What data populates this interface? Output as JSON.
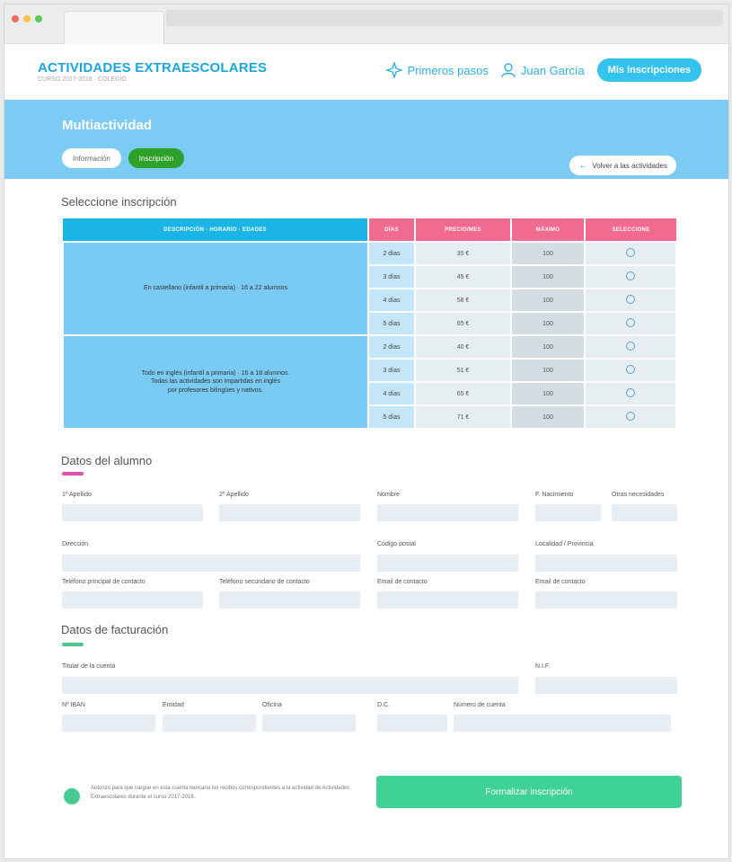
{
  "browser": {
    "dots": [
      "#f36b5b",
      "#f5c342",
      "#5ac85a"
    ]
  },
  "header": {
    "brand_title": "ACTIVIDADES EXTRAESCOLARES",
    "brand_sub": "CURSO 2017-2018 · COLEGIO",
    "nav_first_steps": "Primeros pasos",
    "nav_user": "Juan García",
    "nav_my_inscriptions": "Mis inscripciones"
  },
  "banner": {
    "title": "Multiactividad",
    "tab_info": "Información",
    "tab_inscription": "Inscripción",
    "back_button": "Volver a las actividades"
  },
  "inscription": {
    "section_title": "Seleccione inscripción",
    "columns": [
      "DESCRIPCIÓN · HORARIO · EDADES",
      "DÍAS",
      "PRECIO/MES",
      "MÁXIMO",
      "SELECCIONE"
    ],
    "groups": [
      {
        "description": "En castellano (infantil a primaria) · 16 a 22 alumnos",
        "rows": [
          {
            "days": "2 días",
            "price": "35 €",
            "max": "100"
          },
          {
            "days": "3 días",
            "price": "45 €",
            "max": "100"
          },
          {
            "days": "4 días",
            "price": "58 €",
            "max": "100"
          },
          {
            "days": "5 días",
            "price": "65 €",
            "max": "100"
          }
        ]
      },
      {
        "description_lines": [
          "Todo en inglés (infantil a primaria) · 16 a 18 alumnos.",
          "Todas las actividades son impartidas en inglés",
          "por profesores bilingües y nativos."
        ],
        "rows": [
          {
            "days": "2 días",
            "price": "40 €",
            "max": "100"
          },
          {
            "days": "3 días",
            "price": "51 €",
            "max": "100"
          },
          {
            "days": "4 días",
            "price": "65 €",
            "max": "100"
          },
          {
            "days": "5 días",
            "price": "71 €",
            "max": "100"
          }
        ]
      }
    ]
  },
  "student": {
    "section_title": "Datos del alumno",
    "labels": {
      "surname1": "1º Apellido",
      "surname2": "2º Apellido",
      "name": "Nombre",
      "birth": "F. Nacimiento",
      "other": "Otras necesidades",
      "address": "Dirección",
      "postal": "Código postal",
      "city": "Localidad / Provincia",
      "phone1": "Teléfono principal de contacto",
      "phone2": "Teléfono secundario de contacto",
      "email1": "Email de contacto",
      "email2": "Email de contacto"
    }
  },
  "billing": {
    "section_title": "Datos de facturación",
    "labels": {
      "holder": "Titular de la cuenta",
      "nif": "N.I.F.",
      "iban": "Nº IBAN",
      "entity": "Entidad",
      "office": "Oficina",
      "dc": "D.C.",
      "account": "Número de cuenta"
    }
  },
  "footer": {
    "consent": "Autorizo para que cargue en esta cuenta bancaria los recibos correspondientes a la actividad de Actividades Extraescolares durante el curso 2017-2018.",
    "submit": "Formalizar inscripción"
  },
  "colors": {
    "accent": "#1aa6dc",
    "banner": "#7ccbf5",
    "pink": "#f16a8f",
    "green": "#3ed394",
    "dark_green": "#2ea12a"
  }
}
